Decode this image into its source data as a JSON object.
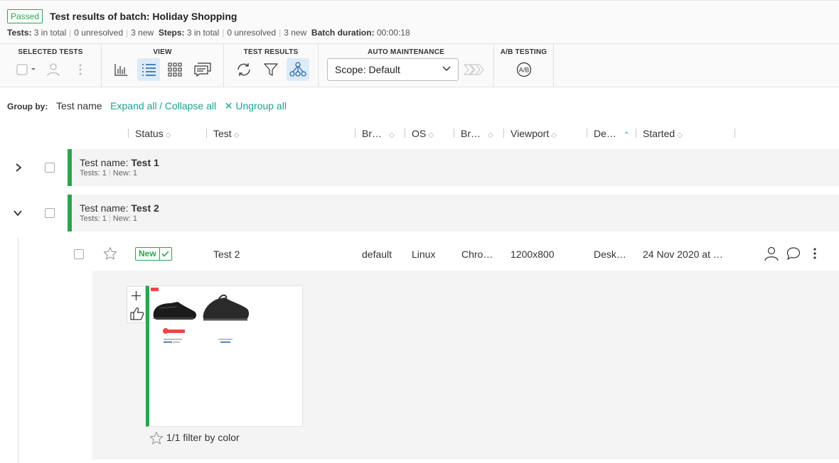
{
  "header": {
    "status_badge": "Passed",
    "title": "Test results of batch: Holiday Shopping",
    "tests_label": "Tests:",
    "tests_total": "3 in total",
    "tests_unresolved": "0 unresolved",
    "tests_new": "3 new",
    "steps_label": "Steps:",
    "steps_total": "3 in total",
    "steps_unresolved": "0 unresolved",
    "steps_new": "3 new",
    "duration_label": "Batch duration:",
    "duration_value": "00:00:18"
  },
  "toolbar": {
    "selected_tests_label": "SELECTED TESTS",
    "view_label": "VIEW",
    "test_results_label": "TEST RESULTS",
    "auto_maintenance_label": "AUTO MAINTENANCE",
    "scope_value": "Scope: Default",
    "ab_testing_label": "A/B TESTING",
    "ab_icon_text": "A/B"
  },
  "grouping": {
    "label": "Group by:",
    "value": "Test name",
    "expand_all": "Expand all",
    "divider": "/",
    "collapse_all": "Collapse all",
    "ungroup_all": "Ungroup all",
    "ungroup_mark": "✕"
  },
  "columns": {
    "status": "Status",
    "test": "Test",
    "branch": "Br…",
    "os": "OS",
    "browser": "Br…",
    "viewport": "Viewport",
    "device": "De…",
    "started": "Started"
  },
  "groups": [
    {
      "prefix": "Test name: ",
      "name": "Test 1",
      "tests": "Tests: 1",
      "new": "New: 1",
      "expanded": false
    },
    {
      "prefix": "Test name: ",
      "name": "Test 2",
      "tests": "Tests: 1",
      "new": "New: 1",
      "expanded": true
    }
  ],
  "test_row": {
    "status": "New",
    "name": "Test 2",
    "branch": "default",
    "os": "Linux",
    "browser": "Chro…",
    "viewport": "1200x800",
    "device": "Desk…",
    "started": "24 Nov 2020 at …"
  },
  "step": {
    "caption": "1/1 filter by color"
  },
  "colors": {
    "passed": "#2da44e",
    "link": "#1aa38f",
    "active_view": "#dcebf7"
  }
}
